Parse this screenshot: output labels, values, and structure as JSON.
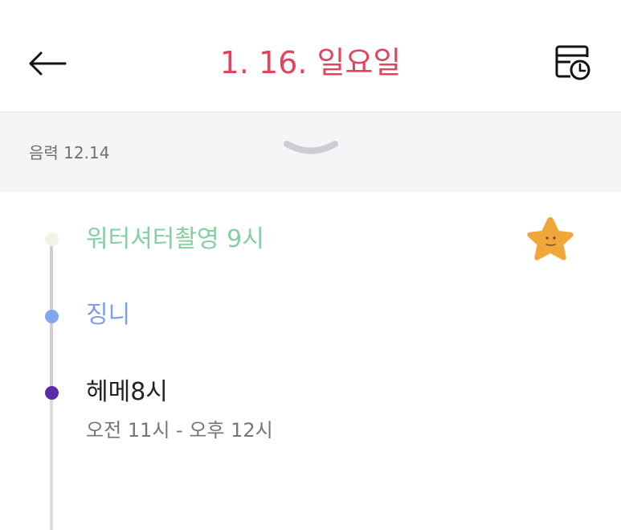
{
  "header": {
    "title": "1. 16. 일요일",
    "back_icon": "arrow-left-icon",
    "history_icon": "calendar-clock-icon",
    "title_color": "#e0455e"
  },
  "lunar": {
    "text": "음력 12.14",
    "expand_icon": "chevron-down-icon"
  },
  "events": [
    {
      "title": "워터셔터촬영 9시",
      "color": "#86cfa0",
      "dot_color": "#eef5e6"
    },
    {
      "title": "징니",
      "color": "#7e9fe6",
      "dot_color": "#82a6f2"
    },
    {
      "title": "헤메8시",
      "time": "오전 11시 - 오후 12시",
      "color": "#222222",
      "dot_color": "#5b2ca8"
    }
  ],
  "sticker": {
    "icon": "star-sticker-icon",
    "color": "#f1a63a"
  }
}
